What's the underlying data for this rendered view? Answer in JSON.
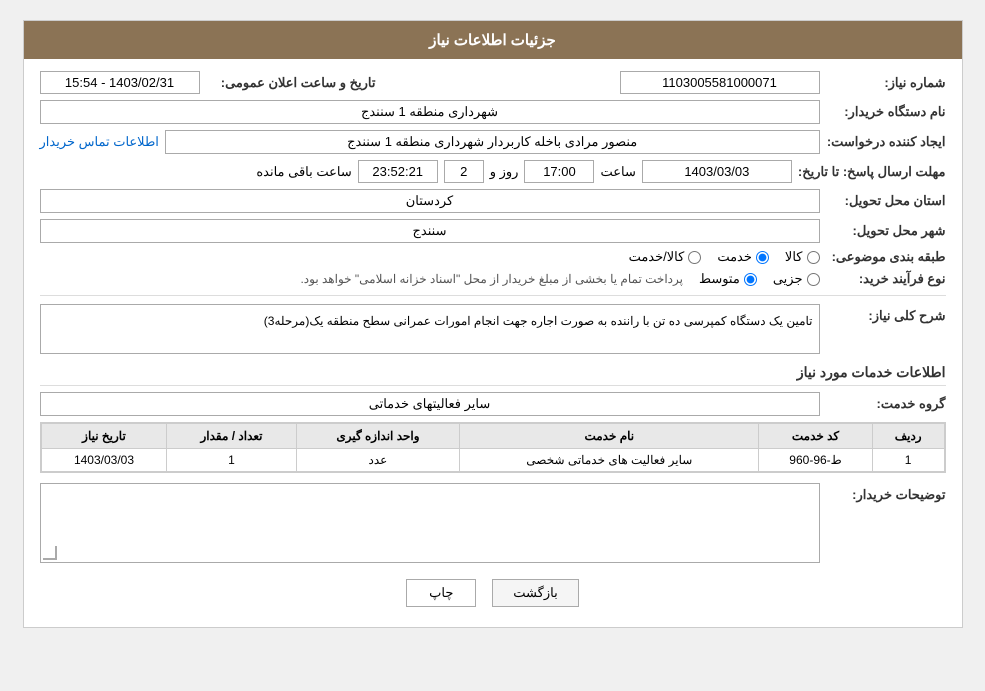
{
  "header": {
    "title": "جزئیات اطلاعات نیاز"
  },
  "fields": {
    "shomareNiaz_label": "شماره نیاز:",
    "shomareNiaz_value": "1103005581000071",
    "namDastgah_label": "نام دستگاه خریدار:",
    "namDastgah_value": "شهرداری منطقه 1 سنندج",
    "tarikh_label": "تاریخ و ساعت اعلان عمومی:",
    "tarikh_value": "1403/02/31 - 15:54",
    "ijadKonande_label": "ایجاد کننده درخواست:",
    "ijadKonande_value": "منصور مرادی باخله کاربردار شهرداری منطقه 1 سنندج",
    "ettelaatTamas_label": "اطلاعات تماس خریدار",
    "mohlatErsal_label": "مهلت ارسال پاسخ: تا تاریخ:",
    "mohlatDate_value": "1403/03/03",
    "mohlatSaat_label": "ساعت",
    "mohlatSaat_value": "17:00",
    "mohlatRooz_label": "روز و",
    "mohlatRooz_value": "2",
    "mohlatSaatMande_label": "ساعت باقی مانده",
    "mohlatSaatMande_value": "23:52:21",
    "ostanTahvil_label": "استان محل تحویل:",
    "ostanTahvil_value": "کردستان",
    "shahrTahvil_label": "شهر محل تحویل:",
    "shahrTahvil_value": "سنندج",
    "tabaqeBandi_label": "طبقه بندی موضوعی:",
    "kala_label": "کالا",
    "khedmat_label": "خدمت",
    "kalaKhedmat_label": "کالا/خدمت",
    "tabaqe_selected": "khedmat",
    "noeFarayand_label": "نوع فرآیند خرید:",
    "jozii_label": "جزیی",
    "mottavasset_label": "متوسط",
    "noeFarayand_selected": "mottavasset",
    "noeFarayand_desc": "پرداخت تمام یا بخشی از مبلغ خریدار از محل \"اسناد خزانه اسلامی\" خواهد بود.",
    "sharhNiaz_label": "شرح کلی نیاز:",
    "sharhNiaz_value": "تامین یک دستگاه کمپرسی ده تن با راننده به صورت اجاره جهت انجام امورات عمرانی سطح منطقه یک(مرحله3)",
    "khadamat_label": "اطلاعات خدمات مورد نیاز",
    "groheKhadamat_label": "گروه خدمت:",
    "groheKhadamat_value": "سایر فعالیتهای خدماتی",
    "table": {
      "headers": [
        "ردیف",
        "کد خدمت",
        "نام خدمت",
        "واحد اندازه گیری",
        "تعداد / مقدار",
        "تاریخ نیاز"
      ],
      "rows": [
        {
          "radif": "1",
          "kodKhadamat": "ط-96-960",
          "namKhadamat": "سایر فعالیت های خدماتی شخصی",
          "vahed": "عدد",
          "tedad": "1",
          "tarikh": "1403/03/03"
        }
      ]
    },
    "tosifikhKharidar_label": "توضیحات خریدار:",
    "tosifikhKharidar_value": ""
  },
  "buttons": {
    "print_label": "چاپ",
    "back_label": "بازگشت"
  }
}
